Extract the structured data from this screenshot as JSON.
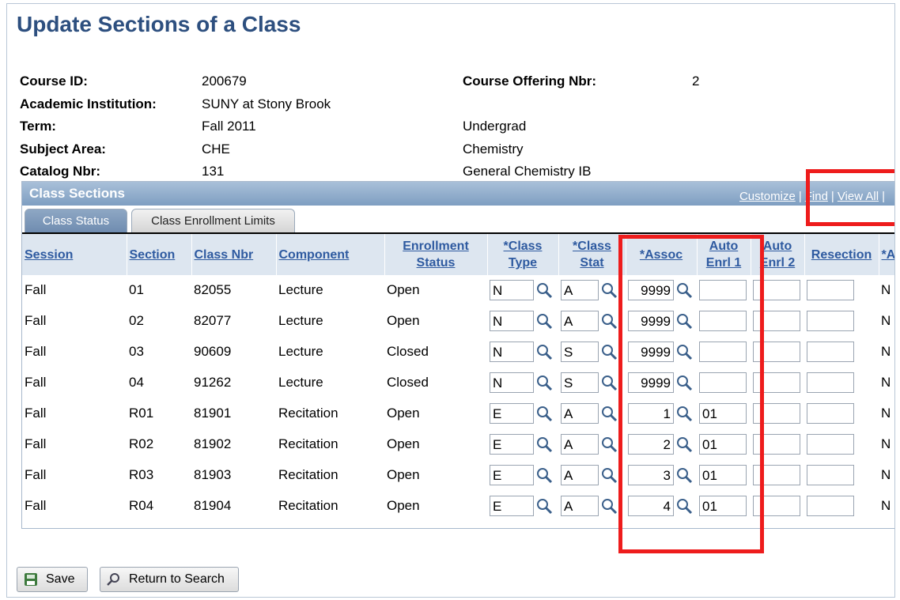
{
  "page": {
    "title": "Update Sections of a Class"
  },
  "course": {
    "course_id_label": "Course ID:",
    "course_id": "200679",
    "offering_label": "Course Offering Nbr:",
    "offering": "2",
    "institution_label": "Academic Institution:",
    "institution": "SUNY at Stony Brook",
    "term_label": "Term:",
    "term": "Fall 2011",
    "career": "Undergrad",
    "subject_label": "Subject Area:",
    "subject": "CHE",
    "subject_desc": "Chemistry",
    "catalog_label": "Catalog Nbr:",
    "catalog": "131",
    "catalog_desc": "General Chemistry IB"
  },
  "grid": {
    "title": "Class Sections",
    "links": {
      "customize": "Customize",
      "find": "Find",
      "view_all": "View All"
    },
    "tabs": {
      "status": "Class Status",
      "limits": "Class Enrollment Limits"
    },
    "columns": {
      "session": "Session",
      "section": "Section",
      "class_nbr": "Class Nbr",
      "component": "Component",
      "enroll_status": "Enrollment Status",
      "class_type": "*Class Type",
      "class_stat": "*Class Stat",
      "assoc": "*Assoc",
      "auto_enrl1": "Auto Enrl 1",
      "auto_enrl2": "Auto Enrl 2",
      "resection": "Resection",
      "ac": "*Ac"
    },
    "rows": [
      {
        "session": "Fall",
        "section": "01",
        "class_nbr": "82055",
        "component": "Lecture",
        "status": "Open",
        "type": "N",
        "stat": "A",
        "assoc": "9999",
        "enrl1": "",
        "flag": "N"
      },
      {
        "session": "Fall",
        "section": "02",
        "class_nbr": "82077",
        "component": "Lecture",
        "status": "Open",
        "type": "N",
        "stat": "A",
        "assoc": "9999",
        "enrl1": "",
        "flag": "N"
      },
      {
        "session": "Fall",
        "section": "03",
        "class_nbr": "90609",
        "component": "Lecture",
        "status": "Closed",
        "type": "N",
        "stat": "S",
        "assoc": "9999",
        "enrl1": "",
        "flag": "N"
      },
      {
        "session": "Fall",
        "section": "04",
        "class_nbr": "91262",
        "component": "Lecture",
        "status": "Closed",
        "type": "N",
        "stat": "S",
        "assoc": "9999",
        "enrl1": "",
        "flag": "N"
      },
      {
        "session": "Fall",
        "section": "R01",
        "class_nbr": "81901",
        "component": "Recitation",
        "status": "Open",
        "type": "E",
        "stat": "A",
        "assoc": "1",
        "enrl1": "01",
        "flag": "N"
      },
      {
        "session": "Fall",
        "section": "R02",
        "class_nbr": "81902",
        "component": "Recitation",
        "status": "Open",
        "type": "E",
        "stat": "A",
        "assoc": "2",
        "enrl1": "01",
        "flag": "N"
      },
      {
        "session": "Fall",
        "section": "R03",
        "class_nbr": "81903",
        "component": "Recitation",
        "status": "Open",
        "type": "E",
        "stat": "A",
        "assoc": "3",
        "enrl1": "01",
        "flag": "N"
      },
      {
        "session": "Fall",
        "section": "R04",
        "class_nbr": "81904",
        "component": "Recitation",
        "status": "Open",
        "type": "E",
        "stat": "A",
        "assoc": "4",
        "enrl1": "01",
        "flag": "N"
      }
    ]
  },
  "buttons": {
    "save": "Save",
    "return": "Return to Search"
  },
  "colors": {
    "title": "#2d4f7f",
    "header_link": "#2e5aa0",
    "annotation": "#ee1c1c"
  },
  "icons": {
    "lookup": "magnifier-icon",
    "save": "save-icon",
    "return": "return-search-icon"
  }
}
